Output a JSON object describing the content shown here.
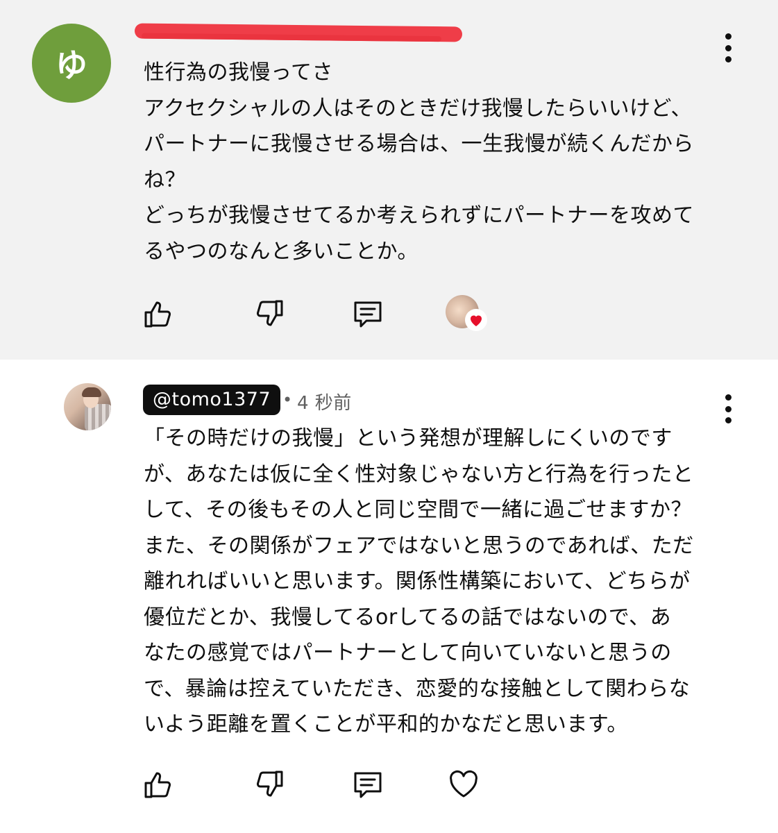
{
  "comments": [
    {
      "avatar_letter": "ゆ",
      "avatar_color": "#6f9e3c",
      "author_redacted": true,
      "body": "性行為の我慢ってさ\nアクセクシャルの人はそのときだけ我慢したらいいけど、\nパートナーに我慢させる場合は、一生我慢が続くんだから\nね？\nどっちが我慢させてるか考えられずにパートナーを攻めて\nるやつのなんと多いことか。",
      "creator_hearted": true,
      "heart_color": "#e6102b"
    },
    {
      "author": "@tomo1377",
      "separator": "•",
      "time": "4 秒前",
      "body": "「その時だけの我慢」という発想が理解しにくいのです\nが、あなたは仮に全く性対象じゃない方と行為を行ったと\nして、その後もその人と同じ空間で一緒に過ごせますか？\nまた、その関係がフェアではないと思うのであれば、ただ\n離れればいいと思います。関係性構築において、どちらが\n優位だとか、我慢してるorしてるの話ではないので、あ\nなたの感覚ではパートナーとして向いていないと思うの\nで、暴論は控えていただき、恋愛的な接触として関わらな\nいよう距離を置くことが平和的かなだと思います。",
      "creator_hearted": false
    }
  ],
  "icons": {
    "like": "thumbs-up-icon",
    "dislike": "thumbs-down-icon",
    "reply": "comment-icon",
    "heart": "heart-icon",
    "menu": "more-vertical-icon"
  },
  "colors": {
    "highlight_bg": "#f2f2f2",
    "redaction": "#ef3d48",
    "badge_bg": "#0f0f0f"
  }
}
